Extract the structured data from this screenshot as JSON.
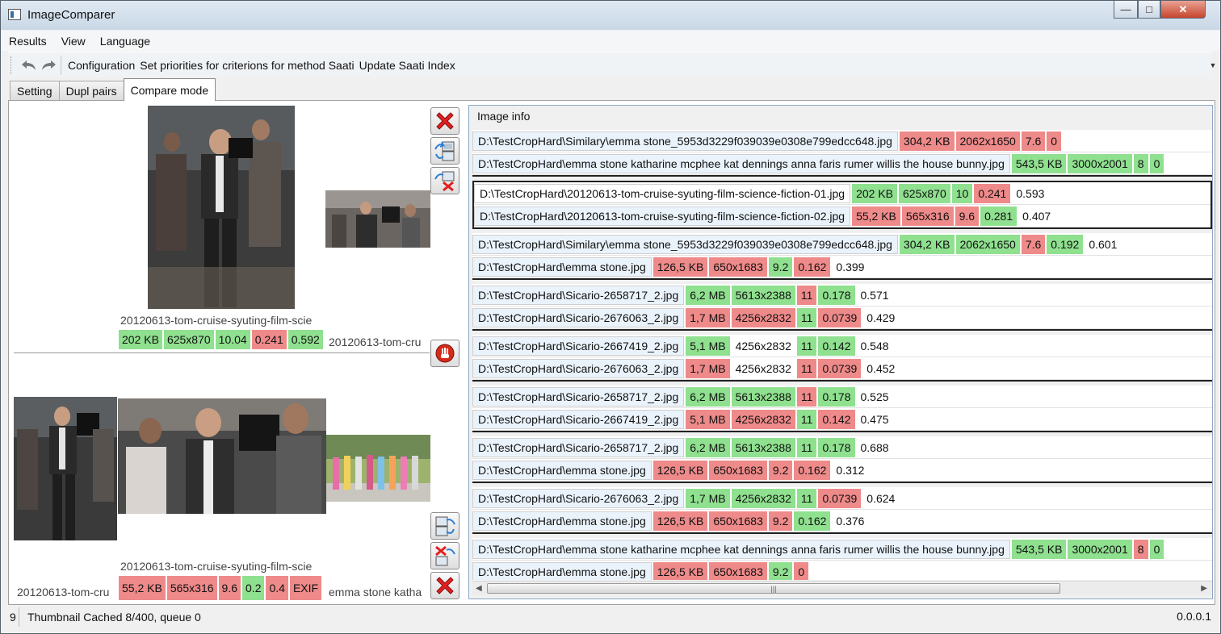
{
  "window": {
    "title": "ImageComparer"
  },
  "menu": [
    "Results",
    "View",
    "Language"
  ],
  "toolbar": {
    "undo_icon": "undo-arrow-icon",
    "redo_icon": "redo-arrow-icon",
    "buttons": [
      "Configuration",
      "Set priorities for criterions for method Saati",
      "Update Saati Index"
    ]
  },
  "tabs": [
    "Setting",
    "Dupl pairs",
    "Compare mode"
  ],
  "active_tab": "Compare mode",
  "compare": {
    "top": {
      "filename": "20120613-tom-cruise-syuting-film-scie",
      "second_filename": "20120613-tom-cru",
      "badges": [
        {
          "text": "202 KB",
          "color": "green"
        },
        {
          "text": "625x870",
          "color": "green"
        },
        {
          "text": "10.04",
          "color": "green"
        },
        {
          "text": "0.241",
          "color": "red"
        },
        {
          "text": "0.592",
          "color": "green"
        }
      ]
    },
    "bottom": {
      "filename": "20120613-tom-cruise-syuting-film-scie",
      "left_filename": "20120613-tom-cru",
      "right_filename": "emma stone katha",
      "badges": [
        {
          "text": "55,2 KB",
          "color": "red"
        },
        {
          "text": "565x316",
          "color": "red"
        },
        {
          "text": "9.6",
          "color": "red"
        },
        {
          "text": "0.2",
          "color": "green"
        },
        {
          "text": "0.4",
          "color": "red"
        },
        {
          "text": "EXIF",
          "color": "red"
        }
      ]
    }
  },
  "image_info": {
    "header": "Image info",
    "groups": [
      {
        "selected": false,
        "rows": [
          {
            "path": "D:\\TestCropHard\\Similary\\emma stone_5953d3229f039039e0308e799edcc648.jpg",
            "size": "304,2 KB",
            "size_c": "red",
            "res": "2062x1650",
            "res_c": "red",
            "q": "7.6",
            "q_c": "red",
            "s": "0",
            "s_c": "red",
            "idx": ""
          },
          {
            "path": "D:\\TestCropHard\\emma stone katharine mcphee kat dennings anna faris rumer willis the house bunny.jpg",
            "size": "543,5 KB",
            "size_c": "green",
            "res": "3000x2001",
            "res_c": "green",
            "q": "8",
            "q_c": "green",
            "s": "0",
            "s_c": "green",
            "idx": ""
          }
        ]
      },
      {
        "selected": true,
        "rows": [
          {
            "path": "D:\\TestCropHard\\20120613-tom-cruise-syuting-film-science-fiction-01.jpg",
            "size": "202 KB",
            "size_c": "green",
            "res": "625x870",
            "res_c": "green",
            "q": "10",
            "q_c": "green",
            "s": "0.241",
            "s_c": "red",
            "idx": "0.593"
          },
          {
            "path": "D:\\TestCropHard\\20120613-tom-cruise-syuting-film-science-fiction-02.jpg",
            "size": "55,2 KB",
            "size_c": "red",
            "res": "565x316",
            "res_c": "red",
            "q": "9.6",
            "q_c": "red",
            "s": "0.281",
            "s_c": "green",
            "idx": "0.407"
          }
        ]
      },
      {
        "selected": false,
        "rows": [
          {
            "path": "D:\\TestCropHard\\Similary\\emma stone_5953d3229f039039e0308e799edcc648.jpg",
            "size": "304,2 KB",
            "size_c": "green",
            "res": "2062x1650",
            "res_c": "green",
            "q": "7.6",
            "q_c": "red",
            "s": "0.192",
            "s_c": "green",
            "idx": "0.601"
          },
          {
            "path": "D:\\TestCropHard\\emma stone.jpg",
            "size": "126,5 KB",
            "size_c": "red",
            "res": "650x1683",
            "res_c": "red",
            "q": "9.2",
            "q_c": "green",
            "s": "0.162",
            "s_c": "red",
            "idx": "0.399"
          }
        ]
      },
      {
        "selected": false,
        "rows": [
          {
            "path": "D:\\TestCropHard\\Sicario-2658717_2.jpg",
            "size": "6,2 MB",
            "size_c": "green",
            "res": "5613x2388",
            "res_c": "green",
            "q": "11",
            "q_c": "red",
            "s": "0.178",
            "s_c": "green",
            "idx": "0.571"
          },
          {
            "path": "D:\\TestCropHard\\Sicario-2676063_2.jpg",
            "size": "1,7 MB",
            "size_c": "red",
            "res": "4256x2832",
            "res_c": "red",
            "q": "11",
            "q_c": "green",
            "s": "0.0739",
            "s_c": "red",
            "idx": "0.429"
          }
        ]
      },
      {
        "selected": false,
        "rows": [
          {
            "path": "D:\\TestCropHard\\Sicario-2667419_2.jpg",
            "size": "5,1 MB",
            "size_c": "green",
            "res": "4256x2832",
            "res_c": "none",
            "q": "11",
            "q_c": "green",
            "s": "0.142",
            "s_c": "green",
            "idx": "0.548"
          },
          {
            "path": "D:\\TestCropHard\\Sicario-2676063_2.jpg",
            "size": "1,7 MB",
            "size_c": "red",
            "res": "4256x2832",
            "res_c": "none",
            "q": "11",
            "q_c": "red",
            "s": "0.0739",
            "s_c": "red",
            "idx": "0.452"
          }
        ]
      },
      {
        "selected": false,
        "rows": [
          {
            "path": "D:\\TestCropHard\\Sicario-2658717_2.jpg",
            "size": "6,2 MB",
            "size_c": "green",
            "res": "5613x2388",
            "res_c": "green",
            "q": "11",
            "q_c": "red",
            "s": "0.178",
            "s_c": "green",
            "idx": "0.525"
          },
          {
            "path": "D:\\TestCropHard\\Sicario-2667419_2.jpg",
            "size": "5,1 MB",
            "size_c": "red",
            "res": "4256x2832",
            "res_c": "red",
            "q": "11",
            "q_c": "green",
            "s": "0.142",
            "s_c": "red",
            "idx": "0.475"
          }
        ]
      },
      {
        "selected": false,
        "rows": [
          {
            "path": "D:\\TestCropHard\\Sicario-2658717_2.jpg",
            "size": "6,2 MB",
            "size_c": "green",
            "res": "5613x2388",
            "res_c": "green",
            "q": "11",
            "q_c": "green",
            "s": "0.178",
            "s_c": "green",
            "idx": "0.688"
          },
          {
            "path": "D:\\TestCropHard\\emma stone.jpg",
            "size": "126,5 KB",
            "size_c": "red",
            "res": "650x1683",
            "res_c": "red",
            "q": "9.2",
            "q_c": "red",
            "s": "0.162",
            "s_c": "red",
            "idx": "0.312"
          }
        ]
      },
      {
        "selected": false,
        "rows": [
          {
            "path": "D:\\TestCropHard\\Sicario-2676063_2.jpg",
            "size": "1,7 MB",
            "size_c": "green",
            "res": "4256x2832",
            "res_c": "green",
            "q": "11",
            "q_c": "green",
            "s": "0.0739",
            "s_c": "red",
            "idx": "0.624"
          },
          {
            "path": "D:\\TestCropHard\\emma stone.jpg",
            "size": "126,5 KB",
            "size_c": "red",
            "res": "650x1683",
            "res_c": "red",
            "q": "9.2",
            "q_c": "red",
            "s": "0.162",
            "s_c": "green",
            "idx": "0.376"
          }
        ]
      },
      {
        "selected": false,
        "rows": [
          {
            "path": "D:\\TestCropHard\\emma stone katharine mcphee kat dennings anna faris rumer willis the house bunny.jpg",
            "size": "543,5 KB",
            "size_c": "green",
            "res": "3000x2001",
            "res_c": "green",
            "q": "8",
            "q_c": "red",
            "s": "0",
            "s_c": "green",
            "idx": ""
          },
          {
            "path": "D:\\TestCropHard\\emma stone.jpg",
            "size": "126,5 KB",
            "size_c": "red",
            "res": "650x1683",
            "res_c": "red",
            "q": "9.2",
            "q_c": "green",
            "s": "0",
            "s_c": "red",
            "idx": ""
          }
        ]
      }
    ]
  },
  "status": {
    "count": "9",
    "text": "Thumbnail Cached 8/400, queue 0",
    "version": "0.0.0.1"
  },
  "colors": {
    "good": "#8fe08f",
    "bad": "#ef8a8a",
    "accent": "#8aa7c6"
  }
}
